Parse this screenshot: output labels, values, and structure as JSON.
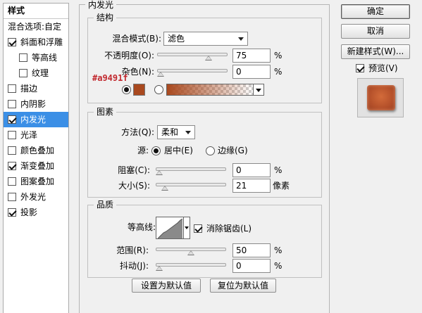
{
  "style_list": {
    "header": "样式",
    "blend_options": "混合选项:自定",
    "items": [
      {
        "label": "斜面和浮雕",
        "checked": true
      },
      {
        "label": "等高线",
        "checked": false
      },
      {
        "label": "纹理",
        "checked": false
      },
      {
        "label": "描边",
        "checked": false
      },
      {
        "label": "内阴影",
        "checked": false
      },
      {
        "label": "内发光",
        "checked": true,
        "selected": true
      },
      {
        "label": "光泽",
        "checked": false
      },
      {
        "label": "颜色叠加",
        "checked": false
      },
      {
        "label": "渐变叠加",
        "checked": true
      },
      {
        "label": "图案叠加",
        "checked": false
      },
      {
        "label": "外发光",
        "checked": false
      },
      {
        "label": "投影",
        "checked": true
      }
    ]
  },
  "panel": {
    "title": "内发光",
    "structure": {
      "title": "结构",
      "blend_mode_label": "混合模式(B):",
      "blend_mode_value": "滤色",
      "opacity_label": "不透明度(O):",
      "opacity_value": "75",
      "opacity_unit": "%",
      "opacity_level": 0.75,
      "noise_label": "杂色(N):",
      "noise_value": "0",
      "noise_unit": "%",
      "noise_level": 0,
      "color_hex_note": "#a9491f",
      "glow_color": "#a9491f"
    },
    "elements": {
      "title": "图素",
      "technique_label": "方法(Q):",
      "technique_value": "柔和",
      "source_label": "源:",
      "source_center": "居中(E)",
      "source_edge": "边缘(G)",
      "choke_label": "阻塞(C):",
      "choke_value": "0",
      "choke_unit": "%",
      "choke_level": 0,
      "size_label": "大小(S):",
      "size_value": "21",
      "size_unit": "像素",
      "size_level": 0.085
    },
    "quality": {
      "title": "品质",
      "contour_label": "等高线:",
      "antialias_label": "消除锯齿(L)",
      "antialias_checked": true,
      "range_label": "范围(R):",
      "range_value": "50",
      "range_unit": "%",
      "range_level": 0.5,
      "jitter_label": "抖动(J):",
      "jitter_value": "0",
      "jitter_unit": "%",
      "jitter_level": 0
    },
    "set_default_label": "设置为默认值",
    "reset_default_label": "复位为默认值"
  },
  "actions": {
    "ok_label": "确定",
    "cancel_label": "取消",
    "new_style_label": "新建样式(W)...",
    "preview_label": "预览(V)",
    "preview_checked": true
  }
}
